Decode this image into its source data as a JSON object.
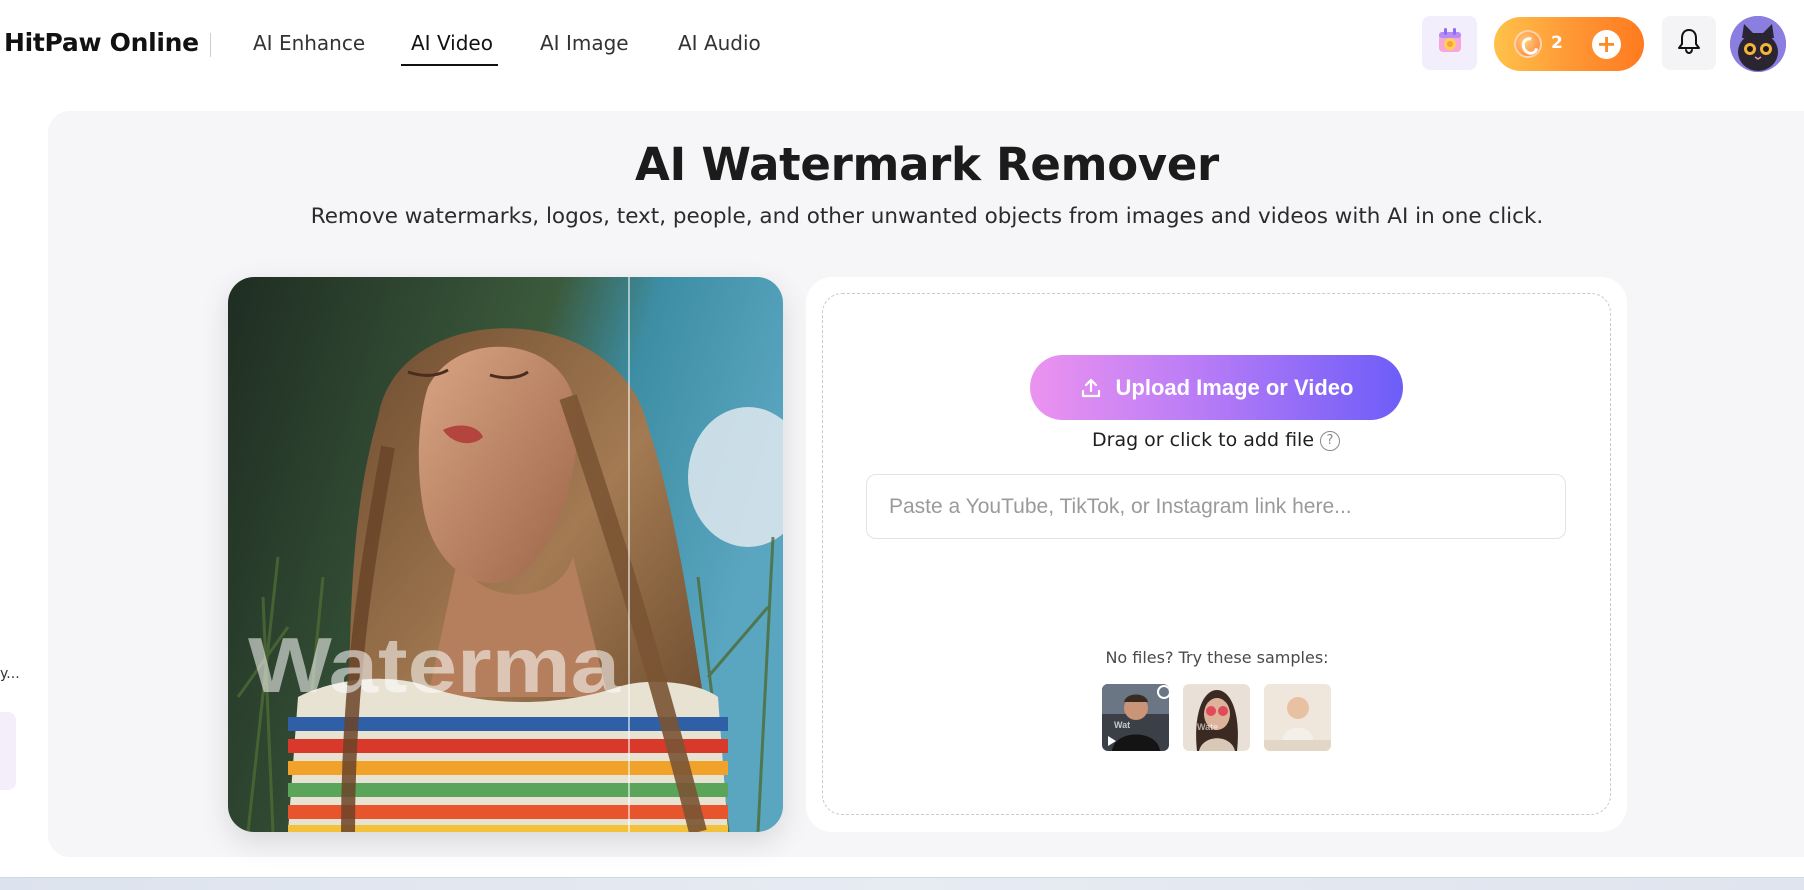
{
  "header": {
    "brand": "HitPaw Online",
    "nav": [
      {
        "label": "AI Enhance",
        "active": false
      },
      {
        "label": "AI Video",
        "active": true
      },
      {
        "label": "AI Image",
        "active": false
      },
      {
        "label": "AI Audio",
        "active": false
      }
    ],
    "credits": "2",
    "credits_add": "+",
    "icons": {
      "gift": "gift-calendar-icon",
      "coin": "credit-coin-icon",
      "bell": "bell-icon",
      "avatar": "cat-avatar"
    }
  },
  "sidebar": {
    "truncated_text": "y..."
  },
  "main": {
    "title": "AI Watermark Remover",
    "subtitle": "Remove watermarks, logos, text, people, and other unwanted objects from images and videos with AI in one click.",
    "preview": {
      "watermark_text": "Waterma"
    },
    "upload": {
      "button_label": "Upload Image or Video",
      "drag_hint": "Drag or click to add file",
      "help_symbol": "?",
      "link_placeholder": "Paste a YouTube, TikTok, or Instagram link here...",
      "link_value": "",
      "samples_label": "No files? Try these samples:",
      "samples": [
        {
          "name": "sample-video-man",
          "kind": "video"
        },
        {
          "name": "sample-image-woman-sunglasses",
          "kind": "image"
        },
        {
          "name": "sample-image-baby",
          "kind": "image"
        }
      ]
    }
  },
  "colors": {
    "accent_gradient_start": "#ec93ef",
    "accent_gradient_end": "#6d5df8",
    "credits_gradient_start": "#ffc24a",
    "credits_gradient_end": "#ff7a1f",
    "card_bg": "#f6f6f8"
  }
}
